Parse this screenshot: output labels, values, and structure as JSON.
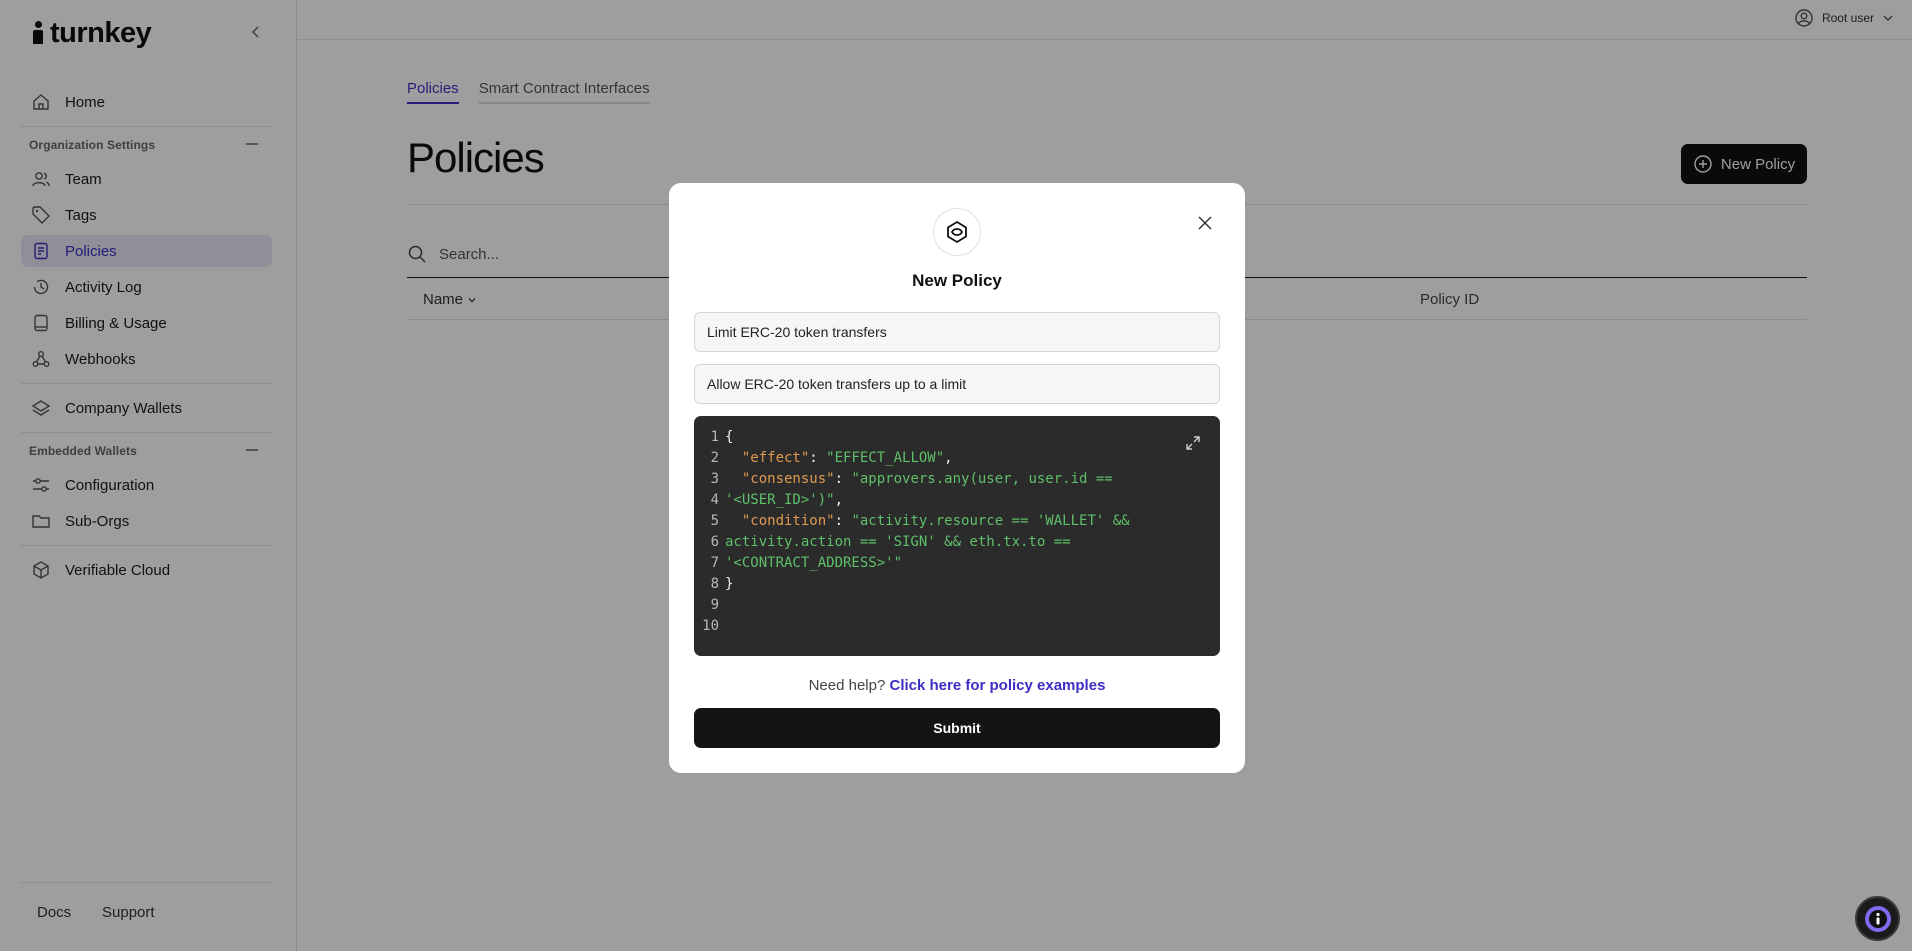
{
  "brand": {
    "name": "turnkey"
  },
  "sidebar": {
    "home": "Home",
    "org_section": "Organization Settings",
    "org_items": [
      {
        "label": "Team",
        "icon": "users-icon"
      },
      {
        "label": "Tags",
        "icon": "tag-icon"
      },
      {
        "label": "Policies",
        "icon": "policy-doc-icon",
        "active": true
      },
      {
        "label": "Activity Log",
        "icon": "history-icon"
      },
      {
        "label": "Billing & Usage",
        "icon": "receipt-icon"
      },
      {
        "label": "Webhooks",
        "icon": "webhook-icon"
      }
    ],
    "company_wallets": "Company Wallets",
    "embedded_section": "Embedded Wallets",
    "embedded_items": [
      {
        "label": "Configuration",
        "icon": "sliders-icon"
      },
      {
        "label": "Sub-Orgs",
        "icon": "folder-icon"
      }
    ],
    "verifiable_cloud": "Verifiable Cloud",
    "footer": {
      "docs": "Docs",
      "support": "Support"
    }
  },
  "topbar": {
    "user_label": "Root user"
  },
  "main": {
    "tabs": [
      {
        "label": "Policies",
        "active": true
      },
      {
        "label": "Smart Contract Interfaces",
        "active": false
      }
    ],
    "title": "Policies",
    "new_policy_button": "New Policy",
    "search_placeholder": "Search...",
    "table_columns": {
      "name": "Name",
      "policy_id": "Policy ID"
    }
  },
  "modal": {
    "title": "New Policy",
    "name_value": "Limit ERC-20 token transfers",
    "description_value": "Allow ERC-20 token transfers up to a limit",
    "code_lines": [
      {
        "n": "1",
        "parts": [
          {
            "t": "{",
            "c": "p"
          }
        ]
      },
      {
        "n": "2",
        "parts": [
          {
            "t": "  \"effect\"",
            "c": "k"
          },
          {
            "t": ": ",
            "c": "p"
          },
          {
            "t": "\"EFFECT_ALLOW\"",
            "c": "s"
          },
          {
            "t": ",",
            "c": "p"
          }
        ]
      },
      {
        "n": "3",
        "parts": [
          {
            "t": "  \"consensus\"",
            "c": "k"
          },
          {
            "t": ": ",
            "c": "p"
          },
          {
            "t": "\"approvers.any(user, user.id ==",
            "c": "s"
          }
        ]
      },
      {
        "n": "4",
        "parts": [
          {
            "t": "'<USER_ID>')\"",
            "c": "s"
          },
          {
            "t": ",",
            "c": "p"
          }
        ]
      },
      {
        "n": "5",
        "parts": [
          {
            "t": "  \"condition\"",
            "c": "k"
          },
          {
            "t": ": ",
            "c": "p"
          },
          {
            "t": "\"activity.resource == 'WALLET' &&",
            "c": "s"
          }
        ]
      },
      {
        "n": "6",
        "parts": [
          {
            "t": "activity.action == 'SIGN' && eth.tx.to ==",
            "c": "s"
          }
        ]
      },
      {
        "n": "7",
        "parts": [
          {
            "t": "'<CONTRACT_ADDRESS>'\"",
            "c": "s"
          }
        ]
      },
      {
        "n": "8",
        "parts": [
          {
            "t": "}",
            "c": "p"
          }
        ]
      },
      {
        "n": "9",
        "parts": []
      },
      {
        "n": "10",
        "parts": []
      }
    ],
    "help_prefix": "Need help?",
    "help_link": "Click here for policy examples",
    "submit": "Submit"
  },
  "colors": {
    "accent": "#3b2fc4",
    "active_bg": "#e8e7f6",
    "editor_bg": "#2b2b2b",
    "code_key": "#e09a4f",
    "code_string": "#5fbf6a",
    "button_dark": "#141414"
  }
}
